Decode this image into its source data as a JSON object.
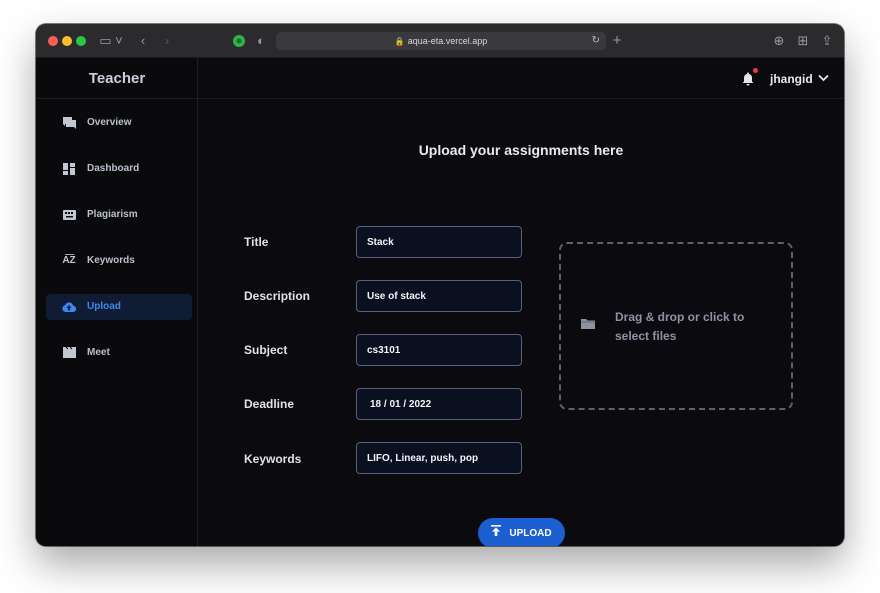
{
  "browser": {
    "url": "aqua-eta.vercel.app"
  },
  "sidebar": {
    "brand": "Teacher",
    "items": [
      {
        "label": "Overview",
        "icon": "chat-icon"
      },
      {
        "label": "Dashboard",
        "icon": "dashboard-icon"
      },
      {
        "label": "Plagiarism",
        "icon": "keyboard-icon"
      },
      {
        "label": "Keywords",
        "icon": "sort-az-icon"
      },
      {
        "label": "Upload",
        "icon": "cloud-upload-icon",
        "active": true
      },
      {
        "label": "Meet",
        "icon": "movie-icon"
      }
    ]
  },
  "header": {
    "username": "jhangid"
  },
  "form": {
    "title": "Upload your assignments here",
    "fields": [
      {
        "label": "Title",
        "value": "Stack"
      },
      {
        "label": "Description",
        "value": "Use of stack"
      },
      {
        "label": "Subject",
        "value": "cs3101"
      },
      {
        "label": "Deadline",
        "value": "18 / 01 / 2022"
      },
      {
        "label": "Keywords",
        "value": "LIFO, Linear, push, pop"
      }
    ],
    "dropzone_text": "Drag & drop or click to select files",
    "upload_label": "UPLOAD"
  },
  "colors": {
    "accent": "#1b5fd1",
    "active_nav": "#3f88f0",
    "notification_dot": "#f0364f"
  }
}
